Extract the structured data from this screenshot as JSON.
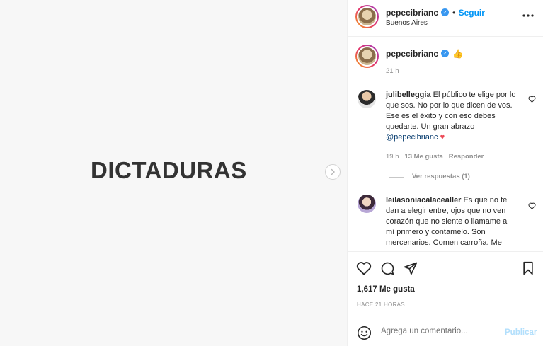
{
  "media": {
    "text": "DICTADURAS"
  },
  "header": {
    "username": "pepecibrianc",
    "follow_label": "Seguir",
    "location": "Buenos Aires"
  },
  "caption": {
    "username": "pepecibrianc",
    "emoji": "👍",
    "time": "21 h"
  },
  "comments": [
    {
      "username": "julibelleggia",
      "text": "El público te elige por lo que sos. No por lo que dicen de vos. Ese es el éxito y con eso debes quedarte. Un gran abrazo",
      "mention": "@pepecibrianc",
      "emoji": "❤️",
      "time": "19 h",
      "likes": "13 Me gusta",
      "reply_label": "Responder",
      "view_replies": "Ver respuestas (1)"
    },
    {
      "username": "leilasoniacalacealler",
      "text": "Es que no te dan a elegir entre, ojos que no ven corazón que no siente o llamame a mí primero y contamelo. Son mercenarios. Comen carroña. Me"
    }
  ],
  "actions": {
    "likes": "1,617 Me gusta",
    "time_ago": "HACE 21 HORAS"
  },
  "comment_box": {
    "placeholder": "Agrega un comentario...",
    "publish_label": "Publicar"
  },
  "colors": {
    "link_blue": "#0095f6",
    "verified_blue": "#3897f0",
    "heart_red": "#ed4956"
  },
  "icons": [
    "verified-badge-icon",
    "more-options-icon",
    "chevron-right-icon",
    "heart-icon",
    "comment-icon",
    "share-icon",
    "bookmark-icon",
    "emoji-icon"
  ]
}
